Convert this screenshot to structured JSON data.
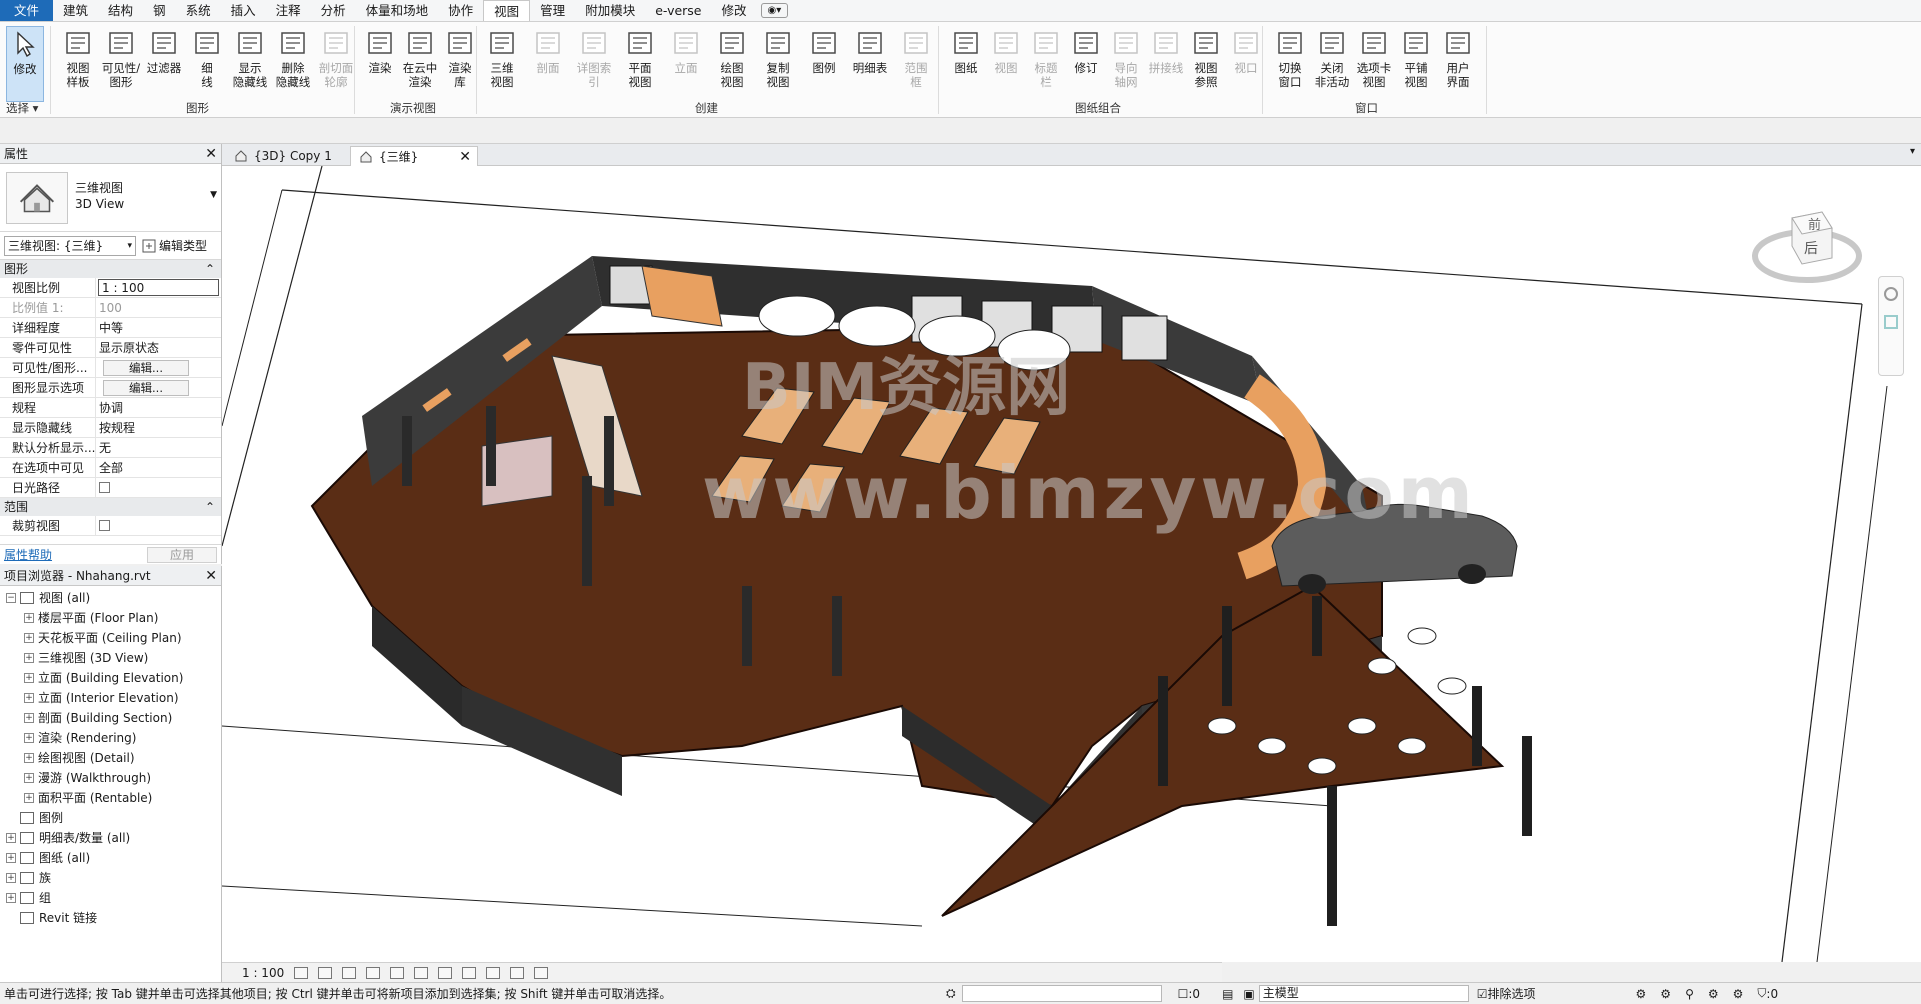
{
  "menu": {
    "tabs": [
      "文件",
      "建筑",
      "结构",
      "钢",
      "系统",
      "插入",
      "注释",
      "分析",
      "体量和场地",
      "协作",
      "视图",
      "管理",
      "附加模块",
      "e-verse",
      "修改"
    ],
    "active_tab": "视图"
  },
  "ribbon": {
    "modify": "修改",
    "select_label": "选择",
    "graphics": {
      "label": "图形",
      "items": [
        "视图\n样板",
        "可见性/\n图形",
        "过滤器",
        "细\n线",
        "显示\n隐藏线",
        "删除\n隐藏线",
        "剖切面\n轮廓"
      ]
    },
    "presentation": {
      "label": "演示视图",
      "items": [
        "渲染",
        "在云中\n渲染",
        "渲染\n库"
      ]
    },
    "create": {
      "label": "创建",
      "items": [
        "三维\n视图",
        "剖面",
        "详图索引",
        "平面\n视图",
        "立面",
        "绘图\n视图",
        "复制\n视图",
        "图例",
        "明细表",
        "范围\n框"
      ]
    },
    "sheet": {
      "label": "图纸组合",
      "items": [
        "图纸",
        "视图",
        "标题\n栏",
        "修订",
        "导向\n轴网",
        "拼接线",
        "视图\n参照",
        "视口"
      ]
    },
    "windows": {
      "label": "窗口",
      "items": [
        "切换\n窗口",
        "关闭\n非活动",
        "选项卡\n视图",
        "平铺\n视图",
        "用户\n界面"
      ]
    }
  },
  "properties": {
    "title": "属性",
    "type_name_cn": "三维视图",
    "type_name_en": "3D View",
    "selector": "三维视图: {三维}",
    "edit_type": "编辑类型",
    "section_graphics": "图形",
    "rows": [
      {
        "k": "视图比例",
        "v": "1 : 100"
      },
      {
        "k": "比例值 1:",
        "v": "100"
      },
      {
        "k": "详细程度",
        "v": "中等"
      },
      {
        "k": "零件可见性",
        "v": "显示原状态"
      },
      {
        "k": "可见性/图形...",
        "v": "编辑..."
      },
      {
        "k": "图形显示选项",
        "v": "编辑..."
      },
      {
        "k": "规程",
        "v": "协调"
      },
      {
        "k": "显示隐藏线",
        "v": "按规程"
      },
      {
        "k": "默认分析显示...",
        "v": "无"
      },
      {
        "k": "在选项中可见",
        "v": "全部"
      },
      {
        "k": "日光路径",
        "v": ""
      }
    ],
    "section_extents": "范围",
    "crop_view": "裁剪视图",
    "help_link": "属性帮助",
    "apply": "应用"
  },
  "browser": {
    "title": "项目浏览器 - Nhahang.rvt",
    "items": [
      {
        "label": "视图 (all)",
        "level": 0,
        "toggle": "−"
      },
      {
        "label": "楼层平面 (Floor Plan)",
        "level": 1,
        "toggle": "+"
      },
      {
        "label": "天花板平面 (Ceiling Plan)",
        "level": 1,
        "toggle": "+"
      },
      {
        "label": "三维视图 (3D View)",
        "level": 1,
        "toggle": "+"
      },
      {
        "label": "立面 (Building Elevation)",
        "level": 1,
        "toggle": "+"
      },
      {
        "label": "立面 (Interior Elevation)",
        "level": 1,
        "toggle": "+"
      },
      {
        "label": "剖面 (Building Section)",
        "level": 1,
        "toggle": "+"
      },
      {
        "label": "渲染 (Rendering)",
        "level": 1,
        "toggle": "+"
      },
      {
        "label": "绘图视图 (Detail)",
        "level": 1,
        "toggle": "+"
      },
      {
        "label": "漫游 (Walkthrough)",
        "level": 1,
        "toggle": "+"
      },
      {
        "label": "面积平面 (Rentable)",
        "level": 1,
        "toggle": "+"
      },
      {
        "label": "图例",
        "level": 0,
        "toggle": ""
      },
      {
        "label": "明细表/数量 (all)",
        "level": 0,
        "toggle": "+"
      },
      {
        "label": "图纸 (all)",
        "level": 0,
        "toggle": "+"
      },
      {
        "label": "族",
        "level": 0,
        "toggle": "+"
      },
      {
        "label": "组",
        "level": 0,
        "toggle": "+"
      },
      {
        "label": "Revit 链接",
        "level": 0,
        "toggle": ""
      }
    ]
  },
  "view_tabs": [
    {
      "label": "{3D} Copy 1",
      "active": false
    },
    {
      "label": "{三维}",
      "active": true
    }
  ],
  "viewcube": {
    "top_face": "前",
    "side_face": "后"
  },
  "view_control_bar": {
    "scale": "1 : 100"
  },
  "status_bar": {
    "message": "单击可进行选择; 按 Tab 键并单击可选择其他项目; 按 Ctrl 键并单击可将新项目添加到选择集; 按 Shift 键并单击可取消选择。",
    "count": ":0",
    "model": "主模型",
    "exclude_options": "排除选项",
    "filter_count": ":0"
  },
  "watermark": {
    "line1": "BIM资源网",
    "line2": "www.bimzyw.com"
  },
  "colors": {
    "accent": "#1e6bb8",
    "floor": "#5a2d15",
    "wall": "#3a3a3a",
    "table_top": "#e8b07a"
  }
}
